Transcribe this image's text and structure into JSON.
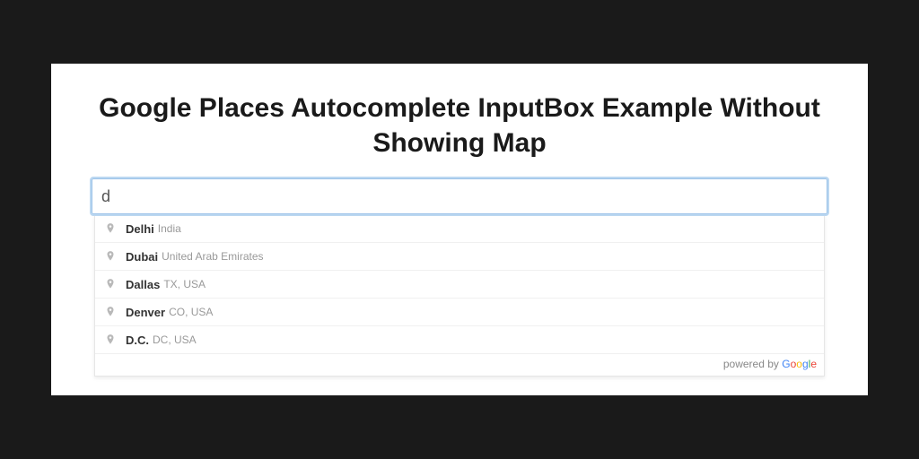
{
  "title": "Google Places Autocomplete InputBox Example Without Showing Map",
  "search": {
    "value": "d",
    "placeholder": ""
  },
  "suggestions": [
    {
      "primary": "Delhi",
      "secondary": "India"
    },
    {
      "primary": "Dubai",
      "secondary": "United Arab Emirates"
    },
    {
      "primary": "Dallas",
      "secondary": "TX, USA"
    },
    {
      "primary": "Denver",
      "secondary": "CO, USA"
    },
    {
      "primary": "D.C.",
      "secondary": "DC, USA"
    }
  ],
  "footer": {
    "prefix": "powered by ",
    "logo_letters": [
      "G",
      "o",
      "o",
      "g",
      "l",
      "e"
    ]
  }
}
